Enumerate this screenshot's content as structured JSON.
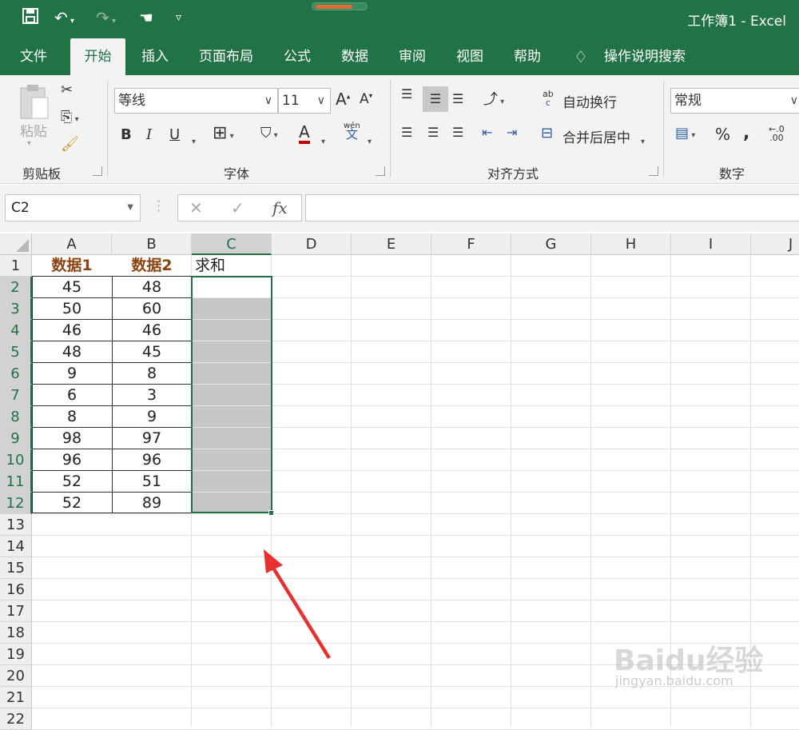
{
  "window": {
    "title": "工作簿1  -  Excel"
  },
  "tabs": [
    "文件",
    "开始",
    "插入",
    "页面布局",
    "公式",
    "数据",
    "审阅",
    "视图",
    "帮助"
  ],
  "tell_me": "操作说明搜索",
  "ribbon": {
    "paste": "粘贴",
    "clipboard": "剪贴板",
    "font_name": "等线",
    "font_size": "11",
    "bold": "B",
    "italic": "I",
    "underline": "U",
    "font_color_glyph": "A",
    "phonetic_top": "wén",
    "phonetic_bottom": "文",
    "font_group": "字体",
    "wrap_text": "自动换行",
    "wrap_icon_top": "ab",
    "wrap_icon_bottom": "c",
    "merge_center": "合并后居中",
    "alignment_group": "对齐方式",
    "number_format": "常规",
    "percent": "%",
    "comma": ",",
    "decimal_top": "←.0",
    "decimal_bottom": ".00",
    "number_group": "数字"
  },
  "formula_bar": {
    "name_box": "C2",
    "cancel": "✕",
    "enter": "✓",
    "fx": "fx",
    "formula": ""
  },
  "columns": [
    "A",
    "B",
    "C",
    "D",
    "E",
    "F",
    "G",
    "H",
    "I",
    "J"
  ],
  "rows": [
    "1",
    "2",
    "3",
    "4",
    "5",
    "6",
    "7",
    "8",
    "9",
    "10",
    "11",
    "12",
    "13",
    "14",
    "15",
    "16",
    "17",
    "18",
    "19",
    "20",
    "21",
    "22"
  ],
  "data": {
    "headers": [
      "数据1",
      "数据2",
      "求和"
    ],
    "values": [
      [
        45,
        48
      ],
      [
        50,
        60
      ],
      [
        46,
        46
      ],
      [
        48,
        45
      ],
      [
        9,
        8
      ],
      [
        6,
        3
      ],
      [
        8,
        9
      ],
      [
        98,
        97
      ],
      [
        96,
        96
      ],
      [
        52,
        51
      ],
      [
        52,
        89
      ]
    ]
  },
  "selection": "C2",
  "colors": {
    "accent": "#217346",
    "header_text": "#8b4513",
    "arrow": "#e8312f",
    "fill": "#c6c6c6"
  },
  "watermark": {
    "brand": "Baidu经验",
    "url": "jingyan.baidu.com"
  }
}
